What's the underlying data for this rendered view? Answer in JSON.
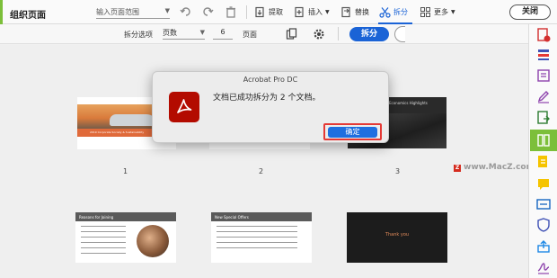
{
  "toolbar": {
    "title": "组织页面",
    "range_placeholder": "输入页面范围",
    "extract": "提取",
    "insert": "插入",
    "replace": "替换",
    "split": "拆分",
    "more": "更多",
    "close": "关闭"
  },
  "split_bar": {
    "options_label": "拆分选项",
    "mode": "页数",
    "count": "6",
    "unit": "页面",
    "split_button": "拆分"
  },
  "pages": [
    {
      "number": "1"
    },
    {
      "number": "2"
    },
    {
      "number": "3"
    }
  ],
  "thumbnails": {
    "p1_heading": "2019 Corporate Society & Sustainability",
    "p3_heading": "Economics Highlights",
    "p4_heading": "Reasons for Joining",
    "p5_heading": "New Special Offers",
    "p6_heading": "Thank you"
  },
  "dialog": {
    "title": "Acrobat Pro DC",
    "message": "文档已成功拆分为 2 个文档。",
    "ok": "确定"
  },
  "watermark": "www.MacZ.com",
  "colors": {
    "accent_blue": "#1a63d6",
    "acrobat_red": "#b30b00",
    "organize_green": "#7cbf3a",
    "highlight_red": "#e53935"
  }
}
